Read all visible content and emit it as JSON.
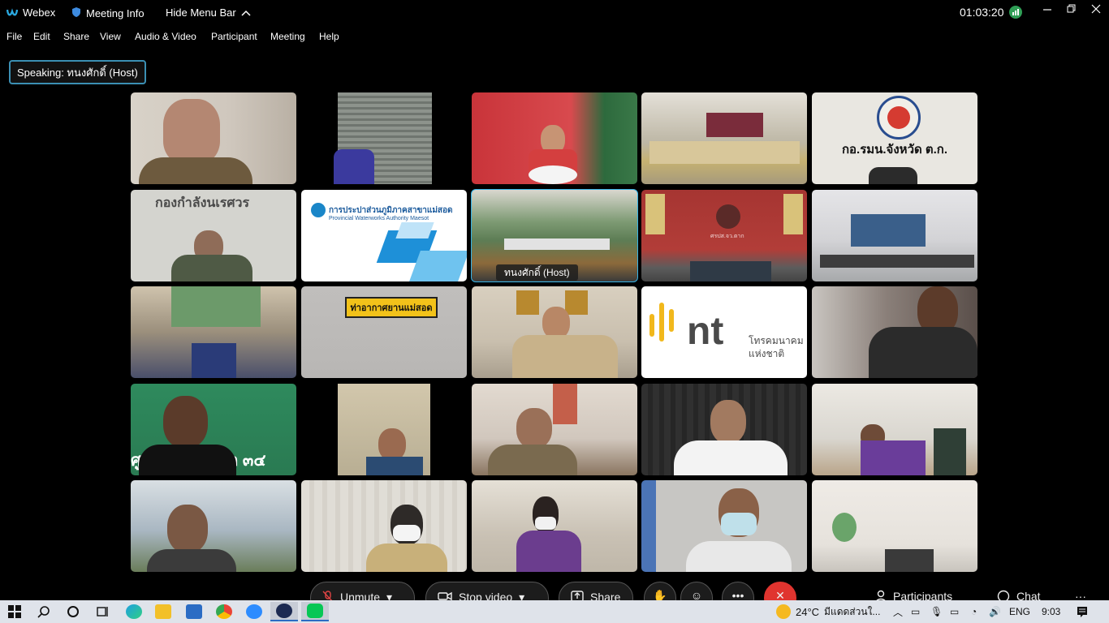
{
  "titlebar": {
    "app_name": "Webex",
    "meeting_info": "Meeting Info",
    "hide_menu_bar": "Hide Menu Bar",
    "timer": "01:03:20"
  },
  "menu": [
    "File",
    "Edit",
    "Share",
    "View",
    "Audio & Video",
    "Participant",
    "Meeting",
    "Help"
  ],
  "speaking": "Speaking: ทนงศักดิ์ (Host)",
  "tiles": {
    "t0": {
      "bg": "#cfc7bd"
    },
    "t1": {
      "bg": "#6e7a75"
    },
    "t2": {
      "bg": "#c9343a"
    },
    "t3": {
      "bg": "#bdb7a5"
    },
    "t4": {
      "bg": "#e9e7e1"
    },
    "t5": {
      "bg": "#d4d4cf"
    },
    "t6": {
      "bg": "#e4f0f8"
    },
    "t7": {
      "bg": "#7d9a73"
    },
    "t8": {
      "bg": "#a63532"
    },
    "t9": {
      "bg": "#d3d3d6"
    },
    "t10": {
      "bg": "#9b8f7c"
    },
    "t11": {
      "bg": "#b8b6b4"
    },
    "t12": {
      "bg": "#c9bfae"
    },
    "t13": {
      "bg": "#ffffff"
    },
    "t14": {
      "bg": "#8a7f79"
    },
    "t15": {
      "bg": "#2e8a5d"
    },
    "t16": {
      "bg": "#d2c7ac"
    },
    "t17": {
      "bg": "#d1c7bd"
    },
    "t18": {
      "bg": "#303030"
    },
    "t19": {
      "bg": "#d9d6cf"
    },
    "t20": {
      "bg": "#a9b7c2"
    },
    "t21": {
      "bg": "#e0ddd6"
    },
    "t22": {
      "bg": "#c9c1b4"
    },
    "t23": {
      "bg": "#c7c6c3"
    },
    "t24": {
      "bg": "#e6e2dc"
    }
  },
  "sign_text_t4": "กอ.รมน.จังหวัด ต.ก.",
  "sign_text_t5": "กองกำลังนเรศวร",
  "waterworks": {
    "thai": "การประปาส่วนภูมิภาคสาขาแม่สอด",
    "eng": "Provincial Waterworks Authority Maesot"
  },
  "host_tag": "ทนงศักดิ์  (Host)",
  "airport_sign": "ท่าอากาศยานแม่สอด",
  "nt": {
    "logo": "nt",
    "line1": "โทรคมนาคม",
    "line2": "แห่งชาติ"
  },
  "sign_text_t15": "ศูปก.   ภ.จว.ตาก  ๓๔",
  "sign_text_t8": "ศรปส.จว.ตาก",
  "controls": {
    "unmute": "Unmute",
    "stop_video": "Stop video",
    "share": "Share",
    "participants": "Participants",
    "chat": "Chat"
  },
  "taskbar": {
    "temp": "24°C",
    "weather": "มีแดดส่วนใ...",
    "lang": "ENG",
    "time": "9:03"
  }
}
